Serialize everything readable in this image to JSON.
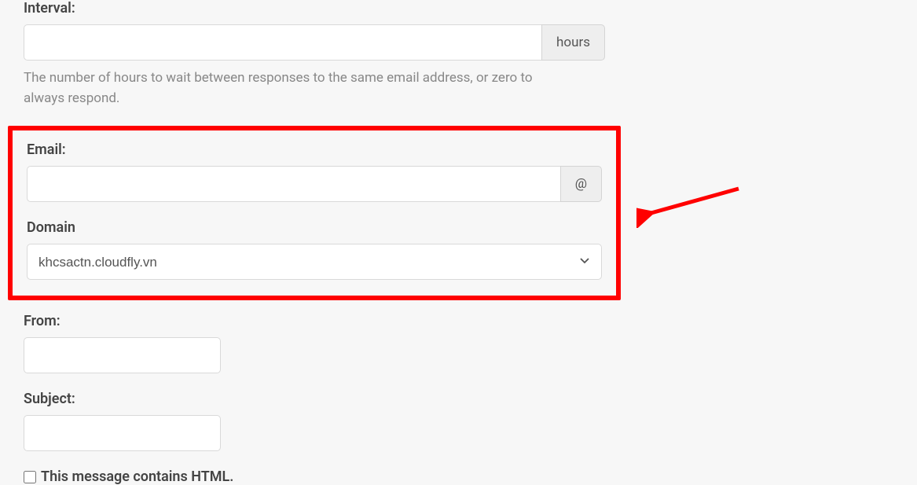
{
  "interval": {
    "label": "Interval:",
    "value": "",
    "addon": "hours",
    "help": "The number of hours to wait between responses to the same email address, or zero to always respond."
  },
  "email": {
    "label": "Email:",
    "value": "",
    "addon": "@"
  },
  "domain": {
    "label": "Domain",
    "value": "khcsactn.cloudfly.vn"
  },
  "from": {
    "label": "From:",
    "value": ""
  },
  "subject": {
    "label": "Subject:",
    "value": ""
  },
  "html_checkbox": {
    "label": "This message contains HTML.",
    "checked": false
  }
}
